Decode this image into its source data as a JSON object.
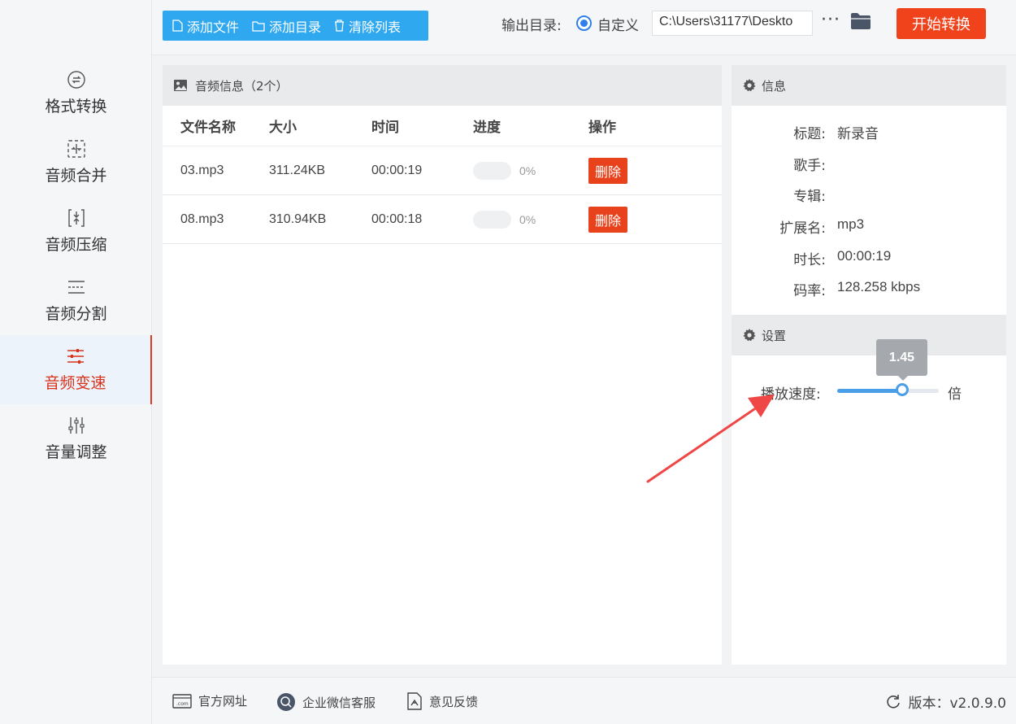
{
  "sidebar": {
    "items": [
      {
        "label": "格式转换",
        "icon": "format-convert-icon",
        "active": false
      },
      {
        "label": "音频合并",
        "icon": "merge-icon",
        "active": false
      },
      {
        "label": "音频压缩",
        "icon": "compress-icon",
        "active": false
      },
      {
        "label": "音频分割",
        "icon": "split-icon",
        "active": false
      },
      {
        "label": "音频变速",
        "icon": "speed-icon",
        "active": true
      },
      {
        "label": "音量调整",
        "icon": "volume-sliders-icon",
        "active": false
      }
    ]
  },
  "toolbar": {
    "add_file": "添加文件",
    "add_dir": "添加目录",
    "clear_list": "清除列表",
    "output_label": "输出目录:",
    "radio_label": "自定义",
    "output_path": "C:\\Users\\31177\\Deskto",
    "more": "···",
    "start": "开始转换"
  },
  "file_panel": {
    "title": "音频信息（2个）",
    "columns": [
      "文件名称",
      "大小",
      "时间",
      "进度",
      "操作"
    ],
    "rows": [
      {
        "name": "03.mp3",
        "size": "311.24KB",
        "time": "00:00:19",
        "progress": "0%",
        "progress_value": 0,
        "action": "删除"
      },
      {
        "name": "08.mp3",
        "size": "310.94KB",
        "time": "00:00:18",
        "progress": "0%",
        "progress_value": 0,
        "action": "删除"
      }
    ]
  },
  "info_panel": {
    "title": "信息",
    "fields": [
      {
        "key": "标题:",
        "value": "新录音"
      },
      {
        "key": "歌手:",
        "value": ""
      },
      {
        "key": "专辑:",
        "value": ""
      },
      {
        "key": "扩展名:",
        "value": "mp3"
      },
      {
        "key": "时长:",
        "value": "00:00:19"
      },
      {
        "key": "码率:",
        "value": "128.258 kbps"
      }
    ]
  },
  "settings_panel": {
    "title": "设置",
    "speed_label": "播放速度:",
    "speed_value": "1.45",
    "speed_fraction": 0.64,
    "unit": "倍"
  },
  "footer": {
    "website": "官方网址",
    "wechat": "企业微信客服",
    "feedback": "意见反馈",
    "version": "版本：v2.0.9.0"
  },
  "colors": {
    "accent": "#2fa8f0",
    "start": "#f0431c",
    "active": "#d8321b",
    "slider": "#4b9fe8",
    "arrow": "#ef4646"
  }
}
